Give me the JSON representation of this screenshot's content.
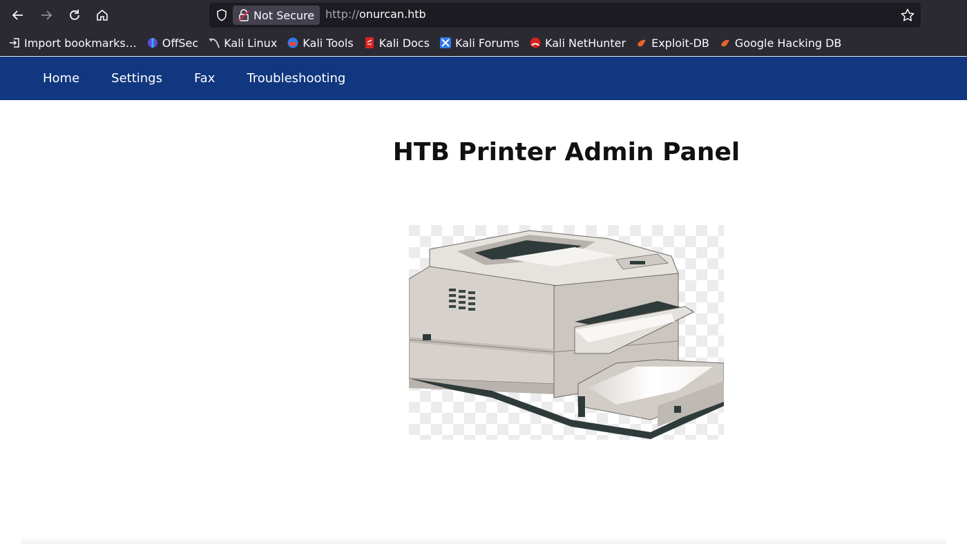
{
  "browser": {
    "security_label": "Not Secure",
    "url_protocol": "http://",
    "url_host": "onurcan.htb",
    "bookmarks": [
      {
        "label": "Import bookmarks…",
        "icon": "import-icon"
      },
      {
        "label": "OffSec",
        "icon": "offsec-icon"
      },
      {
        "label": "Kali Linux",
        "icon": "kali-dragon-icon"
      },
      {
        "label": "Kali Tools",
        "icon": "kali-tools-icon"
      },
      {
        "label": "Kali Docs",
        "icon": "kali-docs-icon"
      },
      {
        "label": "Kali Forums",
        "icon": "kali-forums-icon"
      },
      {
        "label": "Kali NetHunter",
        "icon": "nethunter-icon"
      },
      {
        "label": "Exploit-DB",
        "icon": "exploit-db-icon"
      },
      {
        "label": "Google Hacking DB",
        "icon": "ghdb-icon"
      }
    ]
  },
  "site": {
    "nav": [
      "Home",
      "Settings",
      "Fax",
      "Troubleshooting"
    ],
    "title": "HTB Printer Admin Panel",
    "image_icon": "laser-printer-image"
  },
  "colors": {
    "chrome": "#2b2a33",
    "nav_bar": "#10377f",
    "page_bg": "#ffffff"
  }
}
